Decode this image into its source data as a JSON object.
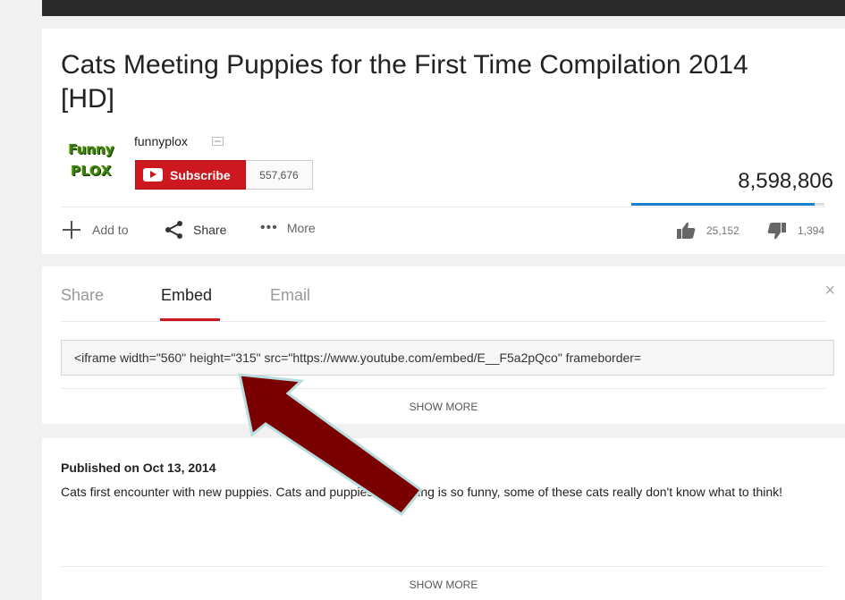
{
  "video": {
    "title": "Cats Meeting Puppies for the First Time Compilation 2014 [HD]",
    "view_count": "8,598,806",
    "like_ratio": 0.948
  },
  "channel": {
    "logo_line1": "Funny",
    "logo_line2": "PLOX",
    "name": "funnyplox",
    "subscribe_label": "Subscribe",
    "subscriber_count": "557,676"
  },
  "actions": {
    "add_label": "Add to",
    "share_label": "Share",
    "more_label": "More",
    "likes": "25,152",
    "dislikes": "1,394"
  },
  "share_panel": {
    "tabs": [
      {
        "label": "Share",
        "active": false
      },
      {
        "label": "Embed",
        "active": true
      },
      {
        "label": "Email",
        "active": false
      }
    ],
    "close_glyph": "×",
    "embed_code": "<iframe width=\"560\" height=\"315\" src=\"https://www.youtube.com/embed/E__F5a2pQco\" frameborder=",
    "show_more_label": "SHOW MORE"
  },
  "description": {
    "published": "Published on Oct 13, 2014",
    "text": "Cats first encounter with new puppies. Cats and puppies interacting is so funny, some of these cats really don't know what to think!",
    "show_more_label": "SHOW MORE"
  },
  "annotation": {
    "arrow_color": "#7a0000",
    "arrow_outline_color": "#b9dde0"
  },
  "icons": {
    "add": "plus-icon",
    "share": "share-icon",
    "more": "more-dots-icon",
    "like": "thumbs-up-icon",
    "dislike": "thumbs-down-icon",
    "subscribe": "youtube-play-icon",
    "verified": "verified-icon",
    "close": "close-icon"
  }
}
